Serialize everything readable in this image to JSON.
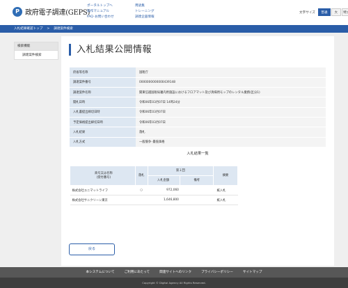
{
  "header": {
    "logo_mark": "P",
    "logo_text": "政府電子調達(GEPS)",
    "links_col1": [
      "ポータルトップへ",
      "操作マニュアル",
      "FAQ･お問い合わせ"
    ],
    "links_col2": [
      "用語集",
      "トレーニング",
      "調達企画情報"
    ],
    "font_size_label": "文字サイズ",
    "font_sizes": [
      "普通",
      "大",
      "特大"
    ],
    "font_size_selected": "普通"
  },
  "breadcrumb": [
    "入札結果確認トップ",
    "調達案件検索"
  ],
  "breadcrumb_sep": ">",
  "sidebar": {
    "header": "検索機能",
    "items": [
      "調達案件検索"
    ]
  },
  "page": {
    "title": "入札結果公開情報",
    "info_rows": [
      {
        "label": "府省等名称",
        "value": "国税庁"
      },
      {
        "label": "調達案件番号",
        "value": "0000000000000439148"
      },
      {
        "label": "調達案件名称",
        "value": "関東信越国税局署内用施設におけるフロアマット及び清掃用モップのレンタル業務(区分1)"
      },
      {
        "label": "開札日時",
        "value": "令和06年03月07日 14時24分"
      },
      {
        "label": "入札書提出締切日時",
        "value": "令和06年03月07日"
      },
      {
        "label": "予定価格提出締切日時",
        "value": "令和06年03月07日"
      },
      {
        "label": "入札結果",
        "value": "落札"
      },
      {
        "label": "入札方式",
        "value": "一般競争･最低価格"
      }
    ],
    "results_title": "入札結果一覧",
    "results_headers": {
      "name": "商号又は名称\n(受付番号)",
      "award": "落札",
      "round": "第１回",
      "amount": "入札金額",
      "note": "備考",
      "remarks": "摘要"
    },
    "results_rows": [
      {
        "name": "株式会社ユニマットライフ",
        "award": "○",
        "amount": "972,060",
        "note": "",
        "remarks": "紙入札"
      },
      {
        "name": "株式会社サニクリーン東京",
        "award": "",
        "amount": "1,646,800",
        "note": "",
        "remarks": "紙入札"
      }
    ],
    "back_button": "戻る"
  },
  "footer": {
    "links": [
      "本システムについて",
      "ご利用にあたって",
      "関連サイトへのリンク",
      "プライバシーポリシー",
      "サイトマップ"
    ],
    "copyright": "Copyright © Digital Agency All Rights Reserved."
  },
  "colors": {
    "accent": "#2a5da8",
    "label_bg": "#dde7f2",
    "footer_bg": "#575757"
  }
}
